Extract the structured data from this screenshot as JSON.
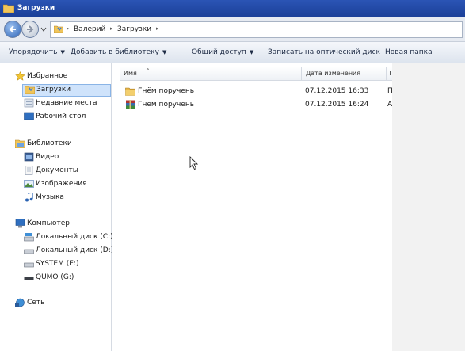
{
  "window": {
    "title": "Загрузки"
  },
  "address": {
    "crumbs": [
      "Валерий",
      "Загрузки"
    ]
  },
  "toolbar": {
    "organize": "Упорядочить",
    "add_library": "Добавить в библиотеку",
    "share": "Общий доступ",
    "burn": "Записать на оптический диск",
    "new_folder": "Новая папка"
  },
  "nav": {
    "favorites": {
      "label": "Избранное",
      "items": [
        "Загрузки",
        "Недавние места",
        "Рабочий стол"
      ]
    },
    "libraries": {
      "label": "Библиотеки",
      "items": [
        "Видео",
        "Документы",
        "Изображения",
        "Музыка"
      ]
    },
    "computer": {
      "label": "Компьютер",
      "items": [
        "Локальный диск (C:)",
        "Локальный диск (D:)",
        "SYSTEM (E:)",
        "QUMO (G:)"
      ]
    },
    "network": {
      "label": "Сеть"
    }
  },
  "columns": {
    "name": "Имя",
    "date": "Дата изменения",
    "type": "Т"
  },
  "files": [
    {
      "name": "Гнём поручень",
      "date": "07.12.2015 16:33",
      "type": "П",
      "icon": "folder-icon"
    },
    {
      "name": "Гнём поручень",
      "date": "07.12.2015 16:24",
      "type": "А",
      "icon": "archive-icon"
    }
  ],
  "colors": {
    "titlebar": "#1a3f97",
    "selection": "#cfe3fb",
    "folder": "#e8b64a"
  }
}
